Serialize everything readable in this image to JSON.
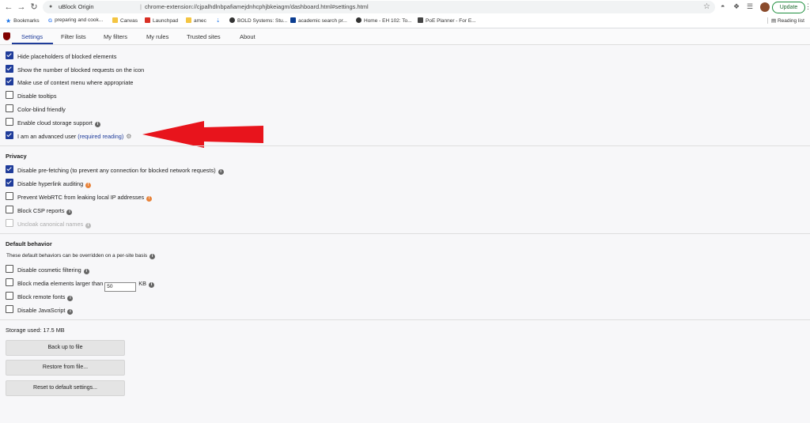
{
  "browser": {
    "tab_title": "uBlock Origin",
    "url": "chrome-extension://cjpalhdlnbpafiamejdnhcphjbkeiagm/dashboard.html#settings.html",
    "separator": "|",
    "update_label": "Update"
  },
  "bookmarks": {
    "items": [
      {
        "label": "Bookmarks",
        "icon": "star-icon",
        "color": "#1a73e8"
      },
      {
        "label": "preparing and cook...",
        "icon": "google-icon",
        "color": "#4285f4"
      },
      {
        "label": "Canvas",
        "icon": "folder-icon",
        "color": "#f4c542"
      },
      {
        "label": "Launchpad",
        "icon": "launchpad-icon",
        "color": "#d93025"
      },
      {
        "label": "amec",
        "icon": "folder-icon",
        "color": "#f4c542"
      },
      {
        "label": "",
        "icon": "download-icon",
        "color": "#1a73e8"
      },
      {
        "label": "BOLD Systems: Stu...",
        "icon": "globe-icon",
        "color": "#333333"
      },
      {
        "label": "academic search pr...",
        "icon": "ebsco-icon",
        "color": "#0b3d91"
      },
      {
        "label": "Home - EH 102: To...",
        "icon": "globe-icon",
        "color": "#333333"
      },
      {
        "label": "PoE Planner - For E...",
        "icon": "poe-icon",
        "color": "#444444"
      }
    ],
    "reading_list": "Reading list"
  },
  "tabs": [
    {
      "label": "Settings",
      "active": true
    },
    {
      "label": "Filter lists",
      "active": false
    },
    {
      "label": "My filters",
      "active": false
    },
    {
      "label": "My rules",
      "active": false
    },
    {
      "label": "Trusted sites",
      "active": false
    },
    {
      "label": "About",
      "active": false
    }
  ],
  "appearance": [
    {
      "label": "Hide placeholders of blocked elements",
      "checked": true
    },
    {
      "label": "Show the number of blocked requests on the icon",
      "checked": true
    },
    {
      "label": "Make use of context menu where appropriate",
      "checked": true
    },
    {
      "label": "Disable tooltips",
      "checked": false
    },
    {
      "label": "Color-blind friendly",
      "checked": false
    },
    {
      "label": "Enable cloud storage support",
      "checked": false,
      "info": true
    },
    {
      "label": "I am an advanced user",
      "checked": true,
      "link": "(required reading)"
    }
  ],
  "privacy": {
    "heading": "Privacy",
    "items": [
      {
        "label": "Disable pre-fetching (to prevent any connection for blocked network requests)",
        "checked": true,
        "info": "gray"
      },
      {
        "label": "Disable hyperlink auditing",
        "checked": true,
        "info": "orange"
      },
      {
        "label": "Prevent WebRTC from leaking local IP addresses",
        "checked": false,
        "info": "orange"
      },
      {
        "label": "Block CSP reports",
        "checked": false,
        "info": "gray"
      },
      {
        "label": "Uncloak canonical names",
        "checked": false,
        "info": "light",
        "disabled": true
      }
    ]
  },
  "default_behavior": {
    "heading": "Default behavior",
    "note": "These default behaviors can be overridden on a per-site basis",
    "cosmetic": "Disable cosmetic filtering",
    "media_prefix": "Block media elements larger than",
    "media_value": "50",
    "media_unit": "KB",
    "fonts": "Block remote fonts",
    "javascript": "Disable JavaScript"
  },
  "storage": {
    "label": "Storage used: 17.5 MB",
    "backup": "Back up to file",
    "restore": "Restore from file...",
    "reset": "Reset to default settings..."
  },
  "colors": {
    "accent": "#1f3c9a",
    "annotation_arrow": "#e8141c",
    "ublock_red": "#800000"
  }
}
